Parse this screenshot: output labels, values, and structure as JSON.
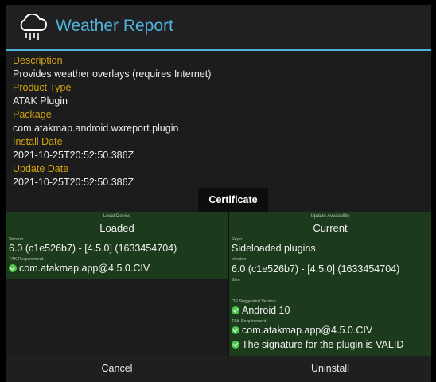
{
  "title": "Weather Report",
  "icon": "cloud-rain-icon",
  "info": [
    {
      "label": "Description",
      "value": "Provides weather overlays (requires Internet)"
    },
    {
      "label": "Product Type",
      "value": "ATAK Plugin"
    },
    {
      "label": "Package",
      "value": "com.atakmap.android.wxreport.plugin"
    },
    {
      "label": "Install Date",
      "value": "2021-10-25T20:52:50.386Z"
    },
    {
      "label": "Update Date",
      "value": "2021-10-25T20:52:50.386Z"
    }
  ],
  "certificate_label": "Certificate",
  "local": {
    "header": "Local Device",
    "status": "Loaded",
    "version_label": "Version",
    "version": "6.0 (c1e526b7) - [4.5.0] (1633454704)",
    "tak_req_label": "TAK Requirement",
    "tak_req": "com.atakmap.app@4.5.0.CIV"
  },
  "update": {
    "header": "Update Availability",
    "status": "Current",
    "repo_label": "Repo",
    "repo": "Sideloaded plugins",
    "version_label": "Version",
    "version": "6.0 (c1e526b7) - [4.5.0] (1633454704)",
    "size_label": "Size",
    "os_label": "OS Suggested Version",
    "os_version": "Android 10",
    "tak_req_label": "TAK Requirement",
    "tak_req": "com.atakmap.app@4.5.0.CIV",
    "signature": "The signature for the plugin is VALID"
  },
  "buttons": {
    "cancel": "Cancel",
    "uninstall": "Uninstall"
  },
  "colors": {
    "accent": "#4fb3d9",
    "label": "#d4a30c",
    "panel": "#1c3a1c",
    "check": "#4cc64c"
  }
}
